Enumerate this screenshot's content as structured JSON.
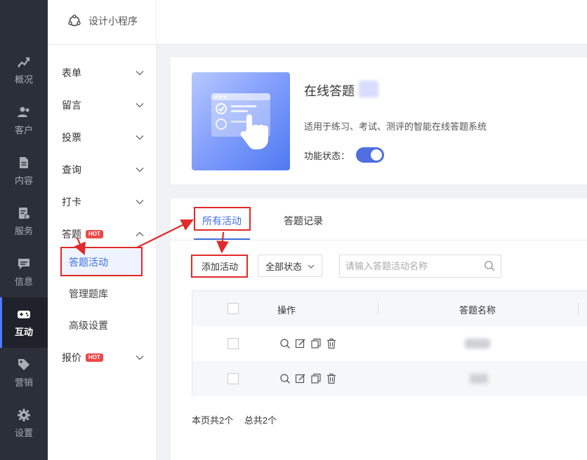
{
  "rail": {
    "items": [
      {
        "label": "概况",
        "icon": "chart-trend-icon"
      },
      {
        "label": "客户",
        "icon": "users-icon"
      },
      {
        "label": "内容",
        "icon": "document-icon"
      },
      {
        "label": "服务",
        "icon": "service-icon"
      },
      {
        "label": "信息",
        "icon": "message-icon"
      },
      {
        "label": "互动",
        "icon": "gamepad-icon"
      },
      {
        "label": "营销",
        "icon": "tag-icon"
      },
      {
        "label": "设置",
        "icon": "gear-icon"
      }
    ],
    "active": "互动"
  },
  "header": {
    "brand": "设计小程序"
  },
  "subnav": {
    "groups": [
      {
        "label": "表单"
      },
      {
        "label": "留言"
      },
      {
        "label": "投票"
      },
      {
        "label": "查询"
      },
      {
        "label": "打卡"
      },
      {
        "label": "答题",
        "badge": "HOT"
      },
      {
        "label": "报价",
        "badge": "HOT"
      }
    ],
    "answer_items": [
      "答题活动",
      "管理题库",
      "高级设置"
    ]
  },
  "app": {
    "title": "在线答题",
    "description": "适用于练习、考试、测评的智能在线答题系统",
    "status_label": "功能状态：",
    "status_on": true
  },
  "tabs": [
    "所有活动",
    "答题记录"
  ],
  "toolbar": {
    "add_label": "添加活动",
    "status_select": "全部状态",
    "search_placeholder": "请输入答题活动名称"
  },
  "table": {
    "headers": [
      "操作",
      "答题名称"
    ],
    "rows": 2
  },
  "pager": {
    "page_total": "本页共2个",
    "all_total": "总共2个"
  },
  "colors": {
    "accent": "#3f6fe0",
    "annotation": "#e12a2a",
    "rail_bg": "#2b2f3a"
  }
}
